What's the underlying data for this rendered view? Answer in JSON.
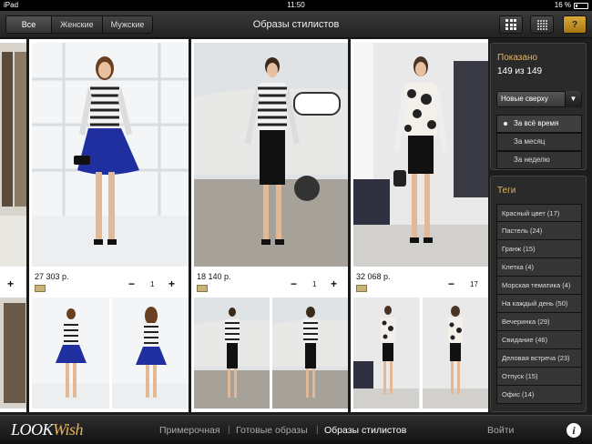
{
  "status": {
    "device": "iPad",
    "time": "11:50",
    "battery": "16 %"
  },
  "topbar": {
    "filters": [
      {
        "label": "Все",
        "active": true
      },
      {
        "label": "Женские",
        "active": false
      },
      {
        "label": "Мужские",
        "active": false
      }
    ],
    "title": "Образы стилистов",
    "help_label": "?"
  },
  "looks": [
    {
      "price": "",
      "qty": ""
    },
    {
      "price": "27 303 р.",
      "qty": "1"
    },
    {
      "price": "18 140 р.",
      "qty": "1"
    },
    {
      "price": "32 068 р.",
      "qty": "17"
    }
  ],
  "panel": {
    "shown_title": "Показано",
    "shown_count": "149 из 149",
    "sort": "Новые сверху",
    "periods": [
      {
        "label": "За всё время",
        "selected": true
      },
      {
        "label": "За месяц",
        "selected": false
      },
      {
        "label": "За неделю",
        "selected": false
      }
    ],
    "tags_title": "Теги",
    "tags": [
      "Красный цвет (17)",
      "Пастель (24)",
      "Гранж (15)",
      "Клетка (4)",
      "Морская тематика (4)",
      "На каждый день (50)",
      "Вечеринка (29)",
      "Свидание (46)",
      "Деловая встреча (23)",
      "Отпуск (15)",
      "Офис (14)"
    ]
  },
  "bottom": {
    "logo_a": "LOOK",
    "logo_b": "Wish",
    "nav": [
      "Примерочная",
      "Готовые образы",
      "Образы стилистов"
    ],
    "login": "Войти",
    "info": "i"
  }
}
